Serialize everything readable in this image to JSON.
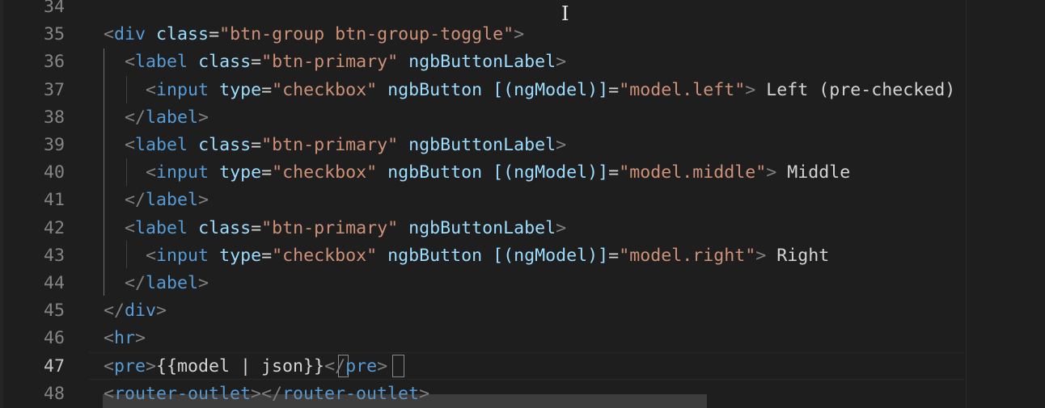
{
  "editor": {
    "language": "html",
    "active_line": 47,
    "line_numbers": [
      "34",
      "35",
      "36",
      "37",
      "38",
      "39",
      "40",
      "41",
      "42",
      "43",
      "44",
      "45",
      "46",
      "47",
      "48"
    ],
    "lines": [
      {
        "tokens": []
      },
      {
        "tokens": [
          {
            "t": "b",
            "v": "<"
          },
          {
            "t": "tag",
            "v": "div"
          },
          {
            "t": "txt",
            "v": " "
          },
          {
            "t": "attr",
            "v": "class"
          },
          {
            "t": "txt",
            "v": "="
          },
          {
            "t": "str",
            "v": "\"btn-group btn-group-toggle\""
          },
          {
            "t": "b",
            "v": ">"
          }
        ]
      },
      {
        "tokens": [
          {
            "t": "txt",
            "v": "  "
          },
          {
            "t": "b",
            "v": "<"
          },
          {
            "t": "tag",
            "v": "label"
          },
          {
            "t": "txt",
            "v": " "
          },
          {
            "t": "attr",
            "v": "class"
          },
          {
            "t": "txt",
            "v": "="
          },
          {
            "t": "str",
            "v": "\"btn-primary\""
          },
          {
            "t": "txt",
            "v": " "
          },
          {
            "t": "attr",
            "v": "ngbButtonLabel"
          },
          {
            "t": "b",
            "v": ">"
          }
        ]
      },
      {
        "tokens": [
          {
            "t": "txt",
            "v": "    "
          },
          {
            "t": "b",
            "v": "<"
          },
          {
            "t": "tag",
            "v": "input"
          },
          {
            "t": "txt",
            "v": " "
          },
          {
            "t": "attr",
            "v": "type"
          },
          {
            "t": "txt",
            "v": "="
          },
          {
            "t": "str",
            "v": "\"checkbox\""
          },
          {
            "t": "txt",
            "v": " "
          },
          {
            "t": "attr",
            "v": "ngbButton"
          },
          {
            "t": "txt",
            "v": " "
          },
          {
            "t": "attr",
            "v": "[(ngModel)]"
          },
          {
            "t": "txt",
            "v": "="
          },
          {
            "t": "str",
            "v": "\"model.left\""
          },
          {
            "t": "b",
            "v": ">"
          },
          {
            "t": "txt",
            "v": " Left (pre-checked)"
          }
        ]
      },
      {
        "tokens": [
          {
            "t": "txt",
            "v": "  "
          },
          {
            "t": "b",
            "v": "</"
          },
          {
            "t": "tag",
            "v": "label"
          },
          {
            "t": "b",
            "v": ">"
          }
        ]
      },
      {
        "tokens": [
          {
            "t": "txt",
            "v": "  "
          },
          {
            "t": "b",
            "v": "<"
          },
          {
            "t": "tag",
            "v": "label"
          },
          {
            "t": "txt",
            "v": " "
          },
          {
            "t": "attr",
            "v": "class"
          },
          {
            "t": "txt",
            "v": "="
          },
          {
            "t": "str",
            "v": "\"btn-primary\""
          },
          {
            "t": "txt",
            "v": " "
          },
          {
            "t": "attr",
            "v": "ngbButtonLabel"
          },
          {
            "t": "b",
            "v": ">"
          }
        ]
      },
      {
        "tokens": [
          {
            "t": "txt",
            "v": "    "
          },
          {
            "t": "b",
            "v": "<"
          },
          {
            "t": "tag",
            "v": "input"
          },
          {
            "t": "txt",
            "v": " "
          },
          {
            "t": "attr",
            "v": "type"
          },
          {
            "t": "txt",
            "v": "="
          },
          {
            "t": "str",
            "v": "\"checkbox\""
          },
          {
            "t": "txt",
            "v": " "
          },
          {
            "t": "attr",
            "v": "ngbButton"
          },
          {
            "t": "txt",
            "v": " "
          },
          {
            "t": "attr",
            "v": "[(ngModel)]"
          },
          {
            "t": "txt",
            "v": "="
          },
          {
            "t": "str",
            "v": "\"model.middle\""
          },
          {
            "t": "b",
            "v": ">"
          },
          {
            "t": "txt",
            "v": " Middle"
          }
        ]
      },
      {
        "tokens": [
          {
            "t": "txt",
            "v": "  "
          },
          {
            "t": "b",
            "v": "</"
          },
          {
            "t": "tag",
            "v": "label"
          },
          {
            "t": "b",
            "v": ">"
          }
        ]
      },
      {
        "tokens": [
          {
            "t": "txt",
            "v": "  "
          },
          {
            "t": "b",
            "v": "<"
          },
          {
            "t": "tag",
            "v": "label"
          },
          {
            "t": "txt",
            "v": " "
          },
          {
            "t": "attr",
            "v": "class"
          },
          {
            "t": "txt",
            "v": "="
          },
          {
            "t": "str",
            "v": "\"btn-primary\""
          },
          {
            "t": "txt",
            "v": " "
          },
          {
            "t": "attr",
            "v": "ngbButtonLabel"
          },
          {
            "t": "b",
            "v": ">"
          }
        ]
      },
      {
        "tokens": [
          {
            "t": "txt",
            "v": "    "
          },
          {
            "t": "b",
            "v": "<"
          },
          {
            "t": "tag",
            "v": "input"
          },
          {
            "t": "txt",
            "v": " "
          },
          {
            "t": "attr",
            "v": "type"
          },
          {
            "t": "txt",
            "v": "="
          },
          {
            "t": "str",
            "v": "\"checkbox\""
          },
          {
            "t": "txt",
            "v": " "
          },
          {
            "t": "attr",
            "v": "ngbButton"
          },
          {
            "t": "txt",
            "v": " "
          },
          {
            "t": "attr",
            "v": "[(ngModel)]"
          },
          {
            "t": "txt",
            "v": "="
          },
          {
            "t": "str",
            "v": "\"model.right\""
          },
          {
            "t": "b",
            "v": ">"
          },
          {
            "t": "txt",
            "v": " Right"
          }
        ]
      },
      {
        "tokens": [
          {
            "t": "txt",
            "v": "  "
          },
          {
            "t": "b",
            "v": "</"
          },
          {
            "t": "tag",
            "v": "label"
          },
          {
            "t": "b",
            "v": ">"
          }
        ]
      },
      {
        "tokens": [
          {
            "t": "b",
            "v": "</"
          },
          {
            "t": "tag",
            "v": "div"
          },
          {
            "t": "b",
            "v": ">"
          }
        ]
      },
      {
        "tokens": [
          {
            "t": "b",
            "v": "<"
          },
          {
            "t": "tag",
            "v": "hr"
          },
          {
            "t": "b",
            "v": ">"
          }
        ]
      },
      {
        "tokens": [
          {
            "t": "b",
            "v": "<"
          },
          {
            "t": "tag",
            "v": "pre"
          },
          {
            "t": "b",
            "v": ">"
          },
          {
            "t": "txt",
            "v": "{{model | json}}"
          },
          {
            "t": "b",
            "v": "</"
          },
          {
            "t": "tag",
            "v": "pre"
          },
          {
            "t": "b",
            "v": ">"
          }
        ]
      },
      {
        "tokens": [
          {
            "t": "b",
            "v": "<"
          },
          {
            "t": "tag",
            "v": "router-outlet"
          },
          {
            "t": "b",
            "v": "></"
          },
          {
            "t": "tag",
            "v": "router-outlet"
          },
          {
            "t": "b",
            "v": ">"
          }
        ]
      }
    ]
  },
  "colors": {
    "background": "#1e1e1e",
    "tag": "#569cd6",
    "attribute": "#9cdcfe",
    "string": "#ce9178",
    "text": "#d4d4d4",
    "bracket": "#808080",
    "line_number": "#858585",
    "line_number_active": "#c6c6c6"
  },
  "cursor_icon": "text-ibeam-cursor-icon"
}
